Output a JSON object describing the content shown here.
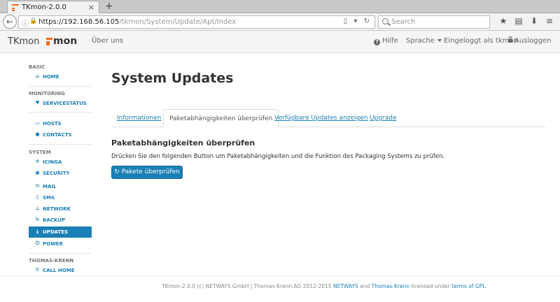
{
  "browser": {
    "tab_title": "TKmon-2.0.0",
    "tab_close": "×",
    "new_tab": "+",
    "url_host": "https://192.168.56.105",
    "url_path": "/tkmon/System/Update/Apt/Index",
    "url_controls": "▯ ▾ ↻",
    "search_placeholder": "Search",
    "nav_icons": [
      "★",
      "▤",
      "⬇",
      "≡"
    ]
  },
  "header": {
    "brand": "TKmon",
    "logo_text": "mon",
    "nav_about": "Über uns",
    "help": "Hilfe",
    "language": "Sprache",
    "logged_in": "Eingeloggt als tkmon",
    "logout": "Ausloggen"
  },
  "sidebar": {
    "basic_heading": "BASIC",
    "home": "HOME",
    "monitoring_heading": "MONITORING",
    "servicestatus": "SERVICESTATUS",
    "hosts": "HOSTS",
    "contacts": "CONTACTS",
    "system_heading": "SYSTEM",
    "icinga": "ICINGA",
    "security": "SECURITY",
    "mail": "MAIL",
    "sms": "SMS",
    "network": "NETWORK",
    "backup": "BACKUP",
    "updates": "UPDATES",
    "power": "POWER",
    "thomas_krenn_heading": "THOMAS-KRENN",
    "call_home": "CALL HOME"
  },
  "main": {
    "title": "System Updates",
    "tabs": [
      "Informationen",
      "Paketabhängigkeiten überprüfen",
      "Verfügbare Updates anzeigen",
      "Upgrade"
    ],
    "active_tab": 1,
    "section_title": "Paketabhängigkeiten überprüfen",
    "section_desc": "Drücken Sie den folgenden Button um Paketabhängigkeiten und die Funktion des Packaging Systems zu prüfen.",
    "check_button": "Pakete überprüfen"
  },
  "footer": {
    "text_before": "TKmon-2.0.0 (c) NETWAYS GmbH | Thomas-Krenn.AG 2012-2015",
    "link_netways": "NETWAYS",
    "and": "and",
    "link_thomas_krenn": "Thomas-Krenn",
    "licensed": "licensed under",
    "link_gpl": "terms of GPL",
    "end": "."
  },
  "colors": {
    "accent": "#1a7fb5",
    "logo_orange": "#f26b1d"
  }
}
